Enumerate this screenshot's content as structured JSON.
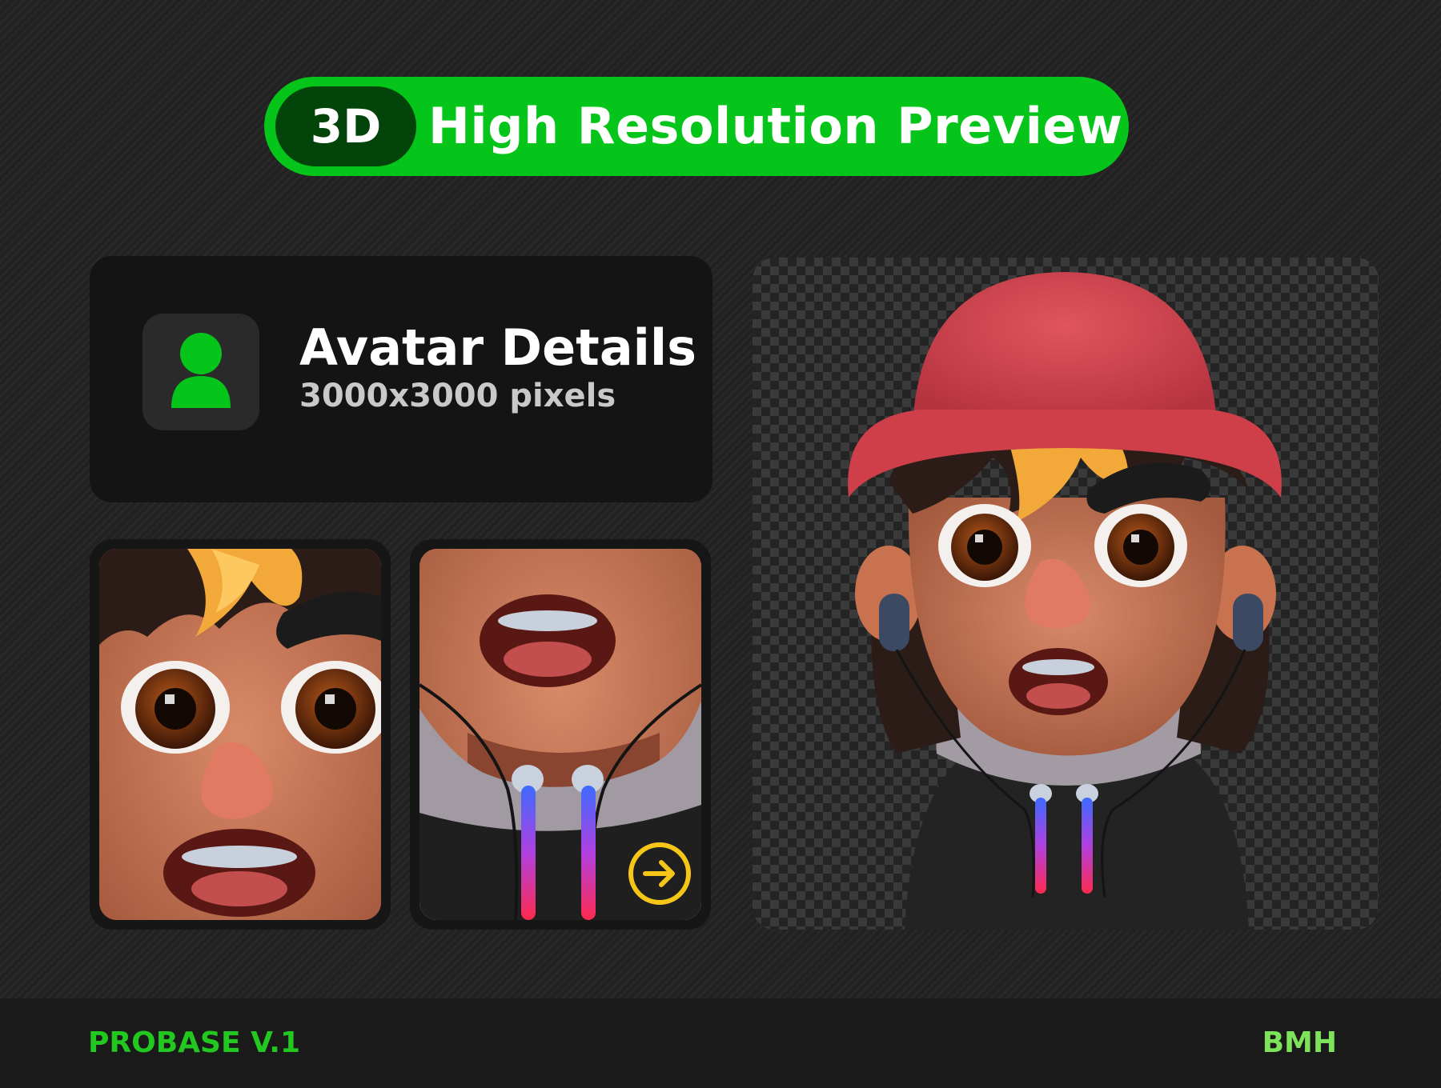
{
  "header": {
    "badge": "3D",
    "title": "High Resolution Preview"
  },
  "info_card": {
    "icon": "user-icon",
    "title": "Avatar Details",
    "subtitle": "3000x3000 pixels"
  },
  "tiles": [
    {
      "name": "face-closeup",
      "subject": "eyes, nose and open mouth"
    },
    {
      "name": "mouth-hoodie-closeup",
      "subject": "mouth, hoodie collar and earphone cables",
      "icon": "arrow-right-circle-icon"
    }
  ],
  "preview": {
    "subject": "3D avatar with red bucket hat, earphones and dark hoodie on transparent background"
  },
  "footer": {
    "left": "PROBASE V.1",
    "right": "BMH"
  },
  "colors": {
    "accent": "#06c51a",
    "accent_dark": "#02440a",
    "background": "#222222",
    "card": "#141414",
    "arrow": "#f5c518"
  }
}
